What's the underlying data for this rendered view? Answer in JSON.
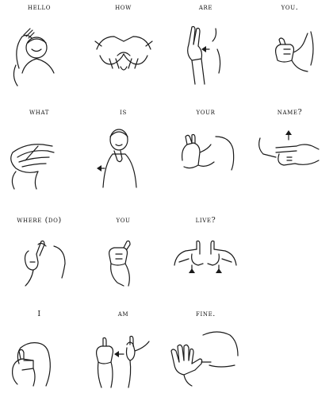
{
  "rows": [
    {
      "signs": [
        {
          "word": "HELLO",
          "illustration": "person-saluting-hand-to-forehead"
        },
        {
          "word": "HOW",
          "illustration": "two-hands-knuckles-together-rolling"
        },
        {
          "word": "ARE",
          "illustration": "hand-r-shape-moving-from-mouth"
        },
        {
          "word": "YOU.",
          "illustration": "index-finger-pointing-forward"
        }
      ]
    },
    {
      "signs": [
        {
          "word": "WHAT",
          "illustration": "index-finger-across-open-palm"
        },
        {
          "word": "IS",
          "illustration": "person-pinky-at-chin-moving-out"
        },
        {
          "word": "YOUR",
          "illustration": "open-palm-facing-forward"
        },
        {
          "word": "NAME?",
          "illustration": "two-h-fingers-tapping"
        }
      ]
    },
    {
      "signs": [
        {
          "word": "WHERE (DO)",
          "illustration": "index-finger-shaking"
        },
        {
          "word": "YOU",
          "illustration": "index-finger-pointing-forward"
        },
        {
          "word": "LIVE?",
          "illustration": "two-l-hands-moving-up-chest"
        }
      ]
    },
    {
      "signs": [
        {
          "word": "I",
          "illustration": "pinky-finger-at-chest"
        },
        {
          "word": "AM",
          "illustration": "thumb-from-chin-forward"
        },
        {
          "word": "FINE.",
          "illustration": "open-hand-thumb-at-chest"
        }
      ]
    }
  ]
}
